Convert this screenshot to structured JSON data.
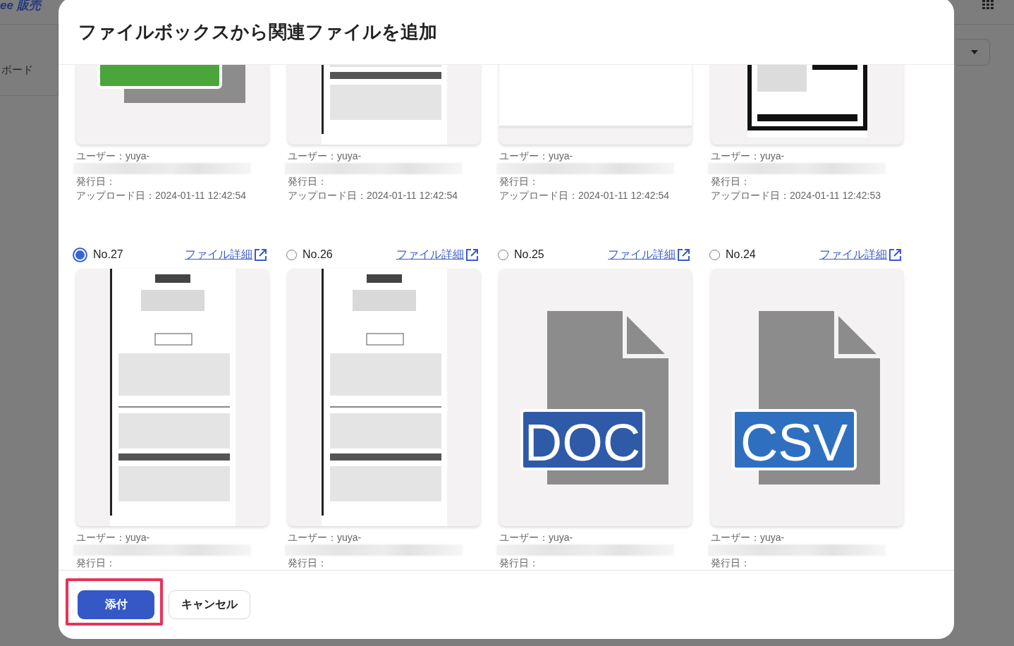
{
  "background": {
    "brand": "ee 販売",
    "nav_item": "ボード"
  },
  "dialog": {
    "title": "ファイルボックスから関連ファイルを追加",
    "files": [
      {
        "thumbnail": {
          "kind": "file-icon",
          "color": "#4aa63a"
        },
        "user": "ユーザー：yuya-",
        "redacted": true,
        "issue_date": "発行日：",
        "upload_date": "アップロード日：2024-01-11 12:42:54"
      },
      {
        "user": "ユーザー：yuya-",
        "redacted": true,
        "issue_date": "発行日：",
        "upload_date": "アップロード日：2024-01-11 12:42:54"
      },
      {
        "user": "ユーザー：yuya-",
        "redacted": true,
        "issue_date": "発行日：",
        "upload_date": "アップロード日：2024-01-11 12:42:54"
      },
      {
        "user": "ユーザー：yuya-",
        "redacted": true,
        "issue_date": "発行日：",
        "upload_date": "アップロード日：2024-01-11 12:42:53"
      },
      {
        "number": "No.27",
        "selected": true,
        "link": "ファイル詳細",
        "user": "ユーザー：yuya-",
        "redacted": true,
        "issue_date": "発行日："
      },
      {
        "number": "No.26",
        "selected": false,
        "link": "ファイル詳細",
        "user": "ユーザー：yuya-",
        "redacted": true,
        "issue_date": "発行日："
      },
      {
        "number": "No.25",
        "selected": false,
        "link": "ファイル詳細",
        "thumbnail": {
          "kind": "file-icon",
          "label": "DOC",
          "color": "#2f5aa8"
        },
        "user": "ユーザー：yuya-",
        "redacted": true,
        "issue_date": "発行日："
      },
      {
        "number": "No.24",
        "selected": false,
        "link": "ファイル詳細",
        "thumbnail": {
          "kind": "file-icon",
          "label": "CSV",
          "color": "#2f6fbf"
        },
        "user": "ユーザー：yuya-",
        "redacted": true,
        "issue_date": "発行日："
      }
    ],
    "buttons": [
      {
        "label": "添付",
        "kind": "primary",
        "highlighted": true
      },
      {
        "label": "キャンセル",
        "kind": "secondary",
        "highlighted": false
      }
    ]
  }
}
